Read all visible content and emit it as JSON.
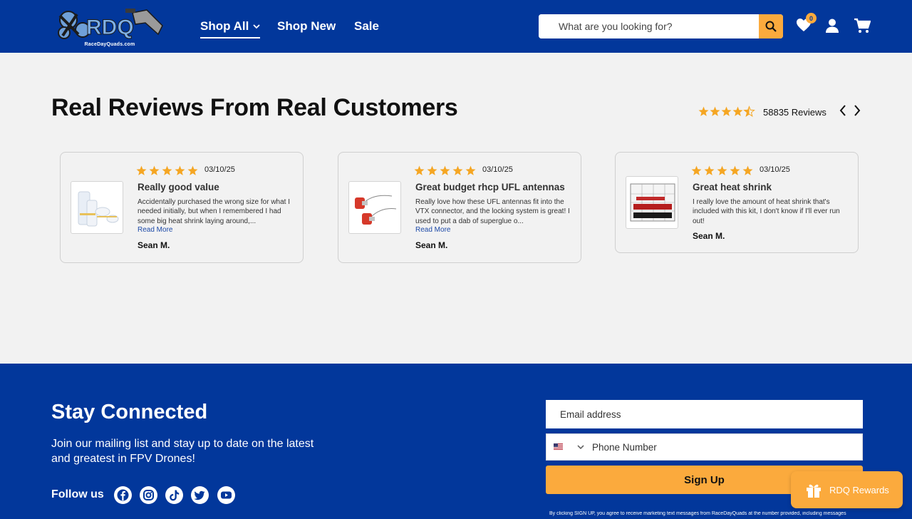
{
  "header": {
    "logo_text": "RaceDayQuads.com",
    "nav": [
      {
        "label": "Shop All"
      },
      {
        "label": "Shop New"
      },
      {
        "label": "Sale"
      }
    ],
    "search": {
      "placeholder": "What are you looking for?"
    },
    "wishlist_count": "0",
    "colors": {
      "brand": "#02379b",
      "accent": "#fbaa3d"
    }
  },
  "reviews": {
    "title": "Real Reviews From Real Customers",
    "rating": 4.5,
    "count_label": "58835 Reviews",
    "items": [
      {
        "stars": 5,
        "date": "03/10/25",
        "title": "Really good value",
        "body": "Accidentally purchased the wrong size for what I needed initially, but when I remembered I had some big heat shrink laying around,...",
        "read_more": "Read More",
        "author": "Sean M."
      },
      {
        "stars": 5,
        "date": "03/10/25",
        "title": "Great budget rhcp UFL antennas",
        "body": "Really love how these UFL antennas fit into the VTX connector, and the locking system is great! I used to put a dab of superglue o...",
        "read_more": "Read More",
        "author": "Sean M."
      },
      {
        "stars": 5,
        "date": "03/10/25",
        "title": "Great heat shrink",
        "body": "I really love the amount of heat shrink that's included with this kit, I don't know if I'll ever run out!",
        "author": "Sean M."
      }
    ]
  },
  "footer": {
    "title": "Stay Connected",
    "subtitle": "Join our mailing list and stay up to date on the latest and greatest in FPV Drones!",
    "follow_label": "Follow us",
    "social": [
      "facebook-icon",
      "instagram-icon",
      "tiktok-icon",
      "twitter-icon",
      "youtube-icon"
    ],
    "email_placeholder": "Email address",
    "phone_placeholder": "Phone Number",
    "signup_label": "Sign Up",
    "disclaimer": "By clicking SIGN UP, you agree to receive marketing text messages from RaceDayQuads at the number provided, including messages"
  },
  "rewards": {
    "label": "RDQ Rewards"
  }
}
